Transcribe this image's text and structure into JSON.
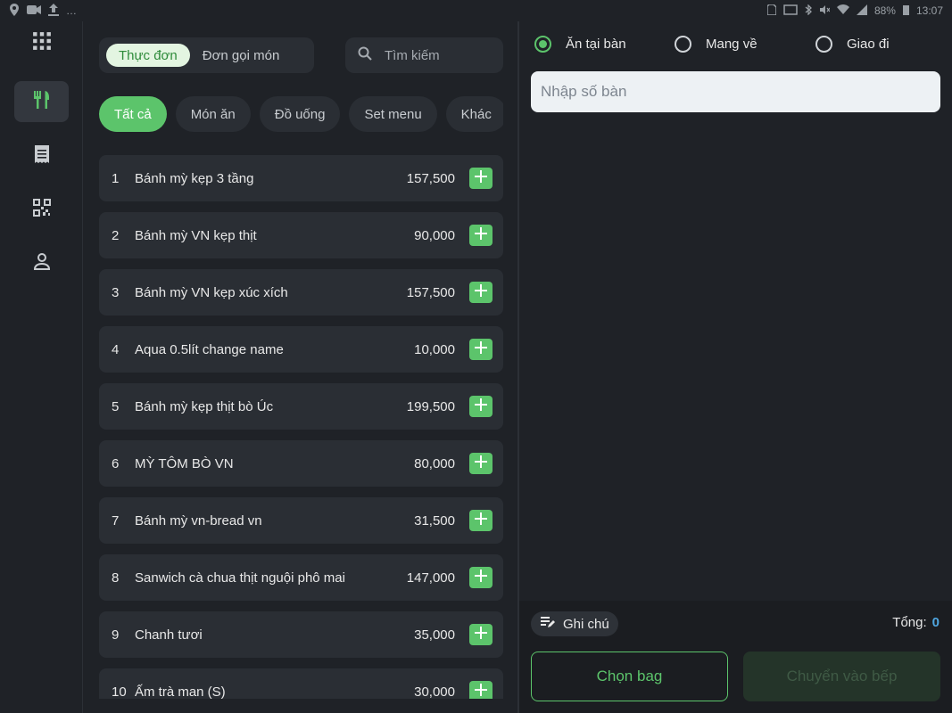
{
  "status_bar": {
    "left_icons": [
      "location-icon",
      "video-icon",
      "upload-icon",
      "more-icon"
    ],
    "battery": "88%",
    "time": "13:07"
  },
  "sidebar": {
    "items": [
      {
        "icon": "apps-grid-icon"
      },
      {
        "icon": "utensils-icon",
        "active": true
      },
      {
        "icon": "receipt-icon"
      },
      {
        "icon": "qr-code-icon"
      },
      {
        "icon": "user-icon"
      }
    ]
  },
  "menu": {
    "tabs": [
      {
        "label": "Thực đơn",
        "active": true
      },
      {
        "label": "Đơn gọi món",
        "active": false
      }
    ],
    "search_placeholder": "Tìm kiếm",
    "categories": [
      {
        "label": "Tất cả",
        "active": true
      },
      {
        "label": "Món ăn"
      },
      {
        "label": "Đồ uống"
      },
      {
        "label": "Set menu"
      },
      {
        "label": "Khác"
      }
    ],
    "items": [
      {
        "num": "1",
        "name": "Bánh mỳ kẹp 3 tầng",
        "price": "157,500"
      },
      {
        "num": "2",
        "name": "Bánh mỳ VN kẹp thịt",
        "price": "90,000"
      },
      {
        "num": "3",
        "name": "Bánh mỳ VN kẹp xúc xích",
        "price": "157,500"
      },
      {
        "num": "4",
        "name": "Aqua 0.5lít change name",
        "price": "10,000"
      },
      {
        "num": "5",
        "name": "Bánh mỳ kẹp thịt bò Úc",
        "price": "199,500"
      },
      {
        "num": "6",
        "name": "MỲ TÔM BÒ VN",
        "price": "80,000"
      },
      {
        "num": "7",
        "name": "Bánh mỳ vn-bread vn",
        "price": "31,500"
      },
      {
        "num": "8",
        "name": "Sanwich cà chua thịt nguội phô mai",
        "price": "147,000"
      },
      {
        "num": "9",
        "name": "Chanh tươi",
        "price": "35,000"
      },
      {
        "num": "10",
        "name": "Ấm trà man (S)",
        "price": "30,000"
      }
    ]
  },
  "order": {
    "order_types": [
      {
        "label": "Ăn tại bàn",
        "selected": true
      },
      {
        "label": "Mang về",
        "selected": false
      },
      {
        "label": "Giao đi",
        "selected": false
      }
    ],
    "table_placeholder": "Nhập số bàn",
    "note_label": "Ghi chú",
    "total_label": "Tổng:",
    "total_value": "0",
    "bag_button": "Chọn bag",
    "kitchen_button": "Chuyển vào bếp"
  },
  "colors": {
    "accent": "#5cc46b",
    "background": "#1f2227",
    "card": "#2a2e34",
    "total_value": "#4fa6e0"
  }
}
